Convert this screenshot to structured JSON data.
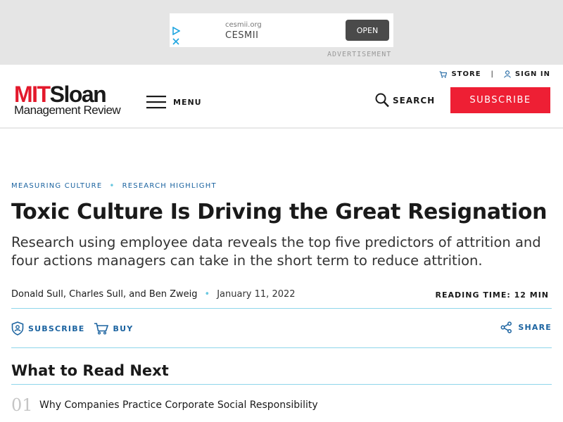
{
  "ad": {
    "domain": "cesmii.org",
    "name": "CESMII",
    "open_label": "OPEN",
    "label": "ADVERTISEMENT"
  },
  "header": {
    "store_label": "STORE",
    "signin_label": "SIGN IN",
    "separator": "|",
    "logo_mit": "MIT",
    "logo_sloan": "Sloan",
    "logo_sub": "Management Review",
    "menu_label": "MENU",
    "search_label": "SEARCH",
    "subscribe_label": "SUBSCRIBE"
  },
  "article": {
    "kicker": [
      "MEASURING CULTURE",
      "RESEARCH HIGHLIGHT"
    ],
    "kicker_dot": "•",
    "title": "Toxic Culture Is Driving the Great Resignation",
    "dek": "Research using employee data reveals the top five predictors of attrition and four actions managers can take in the short term to reduce attrition.",
    "authors": "Donald Sull, Charles Sull, and Ben Zweig",
    "byline_dot": "•",
    "date": "January 11, 2022",
    "reading_time": "READING TIME: 12 MIN",
    "subscribe_label": "SUBSCRIBE",
    "buy_label": "BUY",
    "share_label": "SHARE"
  },
  "read_next": {
    "heading": "What to Read Next",
    "items": [
      {
        "num": "01",
        "title": "Why Companies Practice Corporate Social Responsibility"
      }
    ]
  },
  "colors": {
    "brand_red": "#ee1f34",
    "link_blue": "#1b63a0",
    "rule_cyan": "#8fd6ea"
  }
}
